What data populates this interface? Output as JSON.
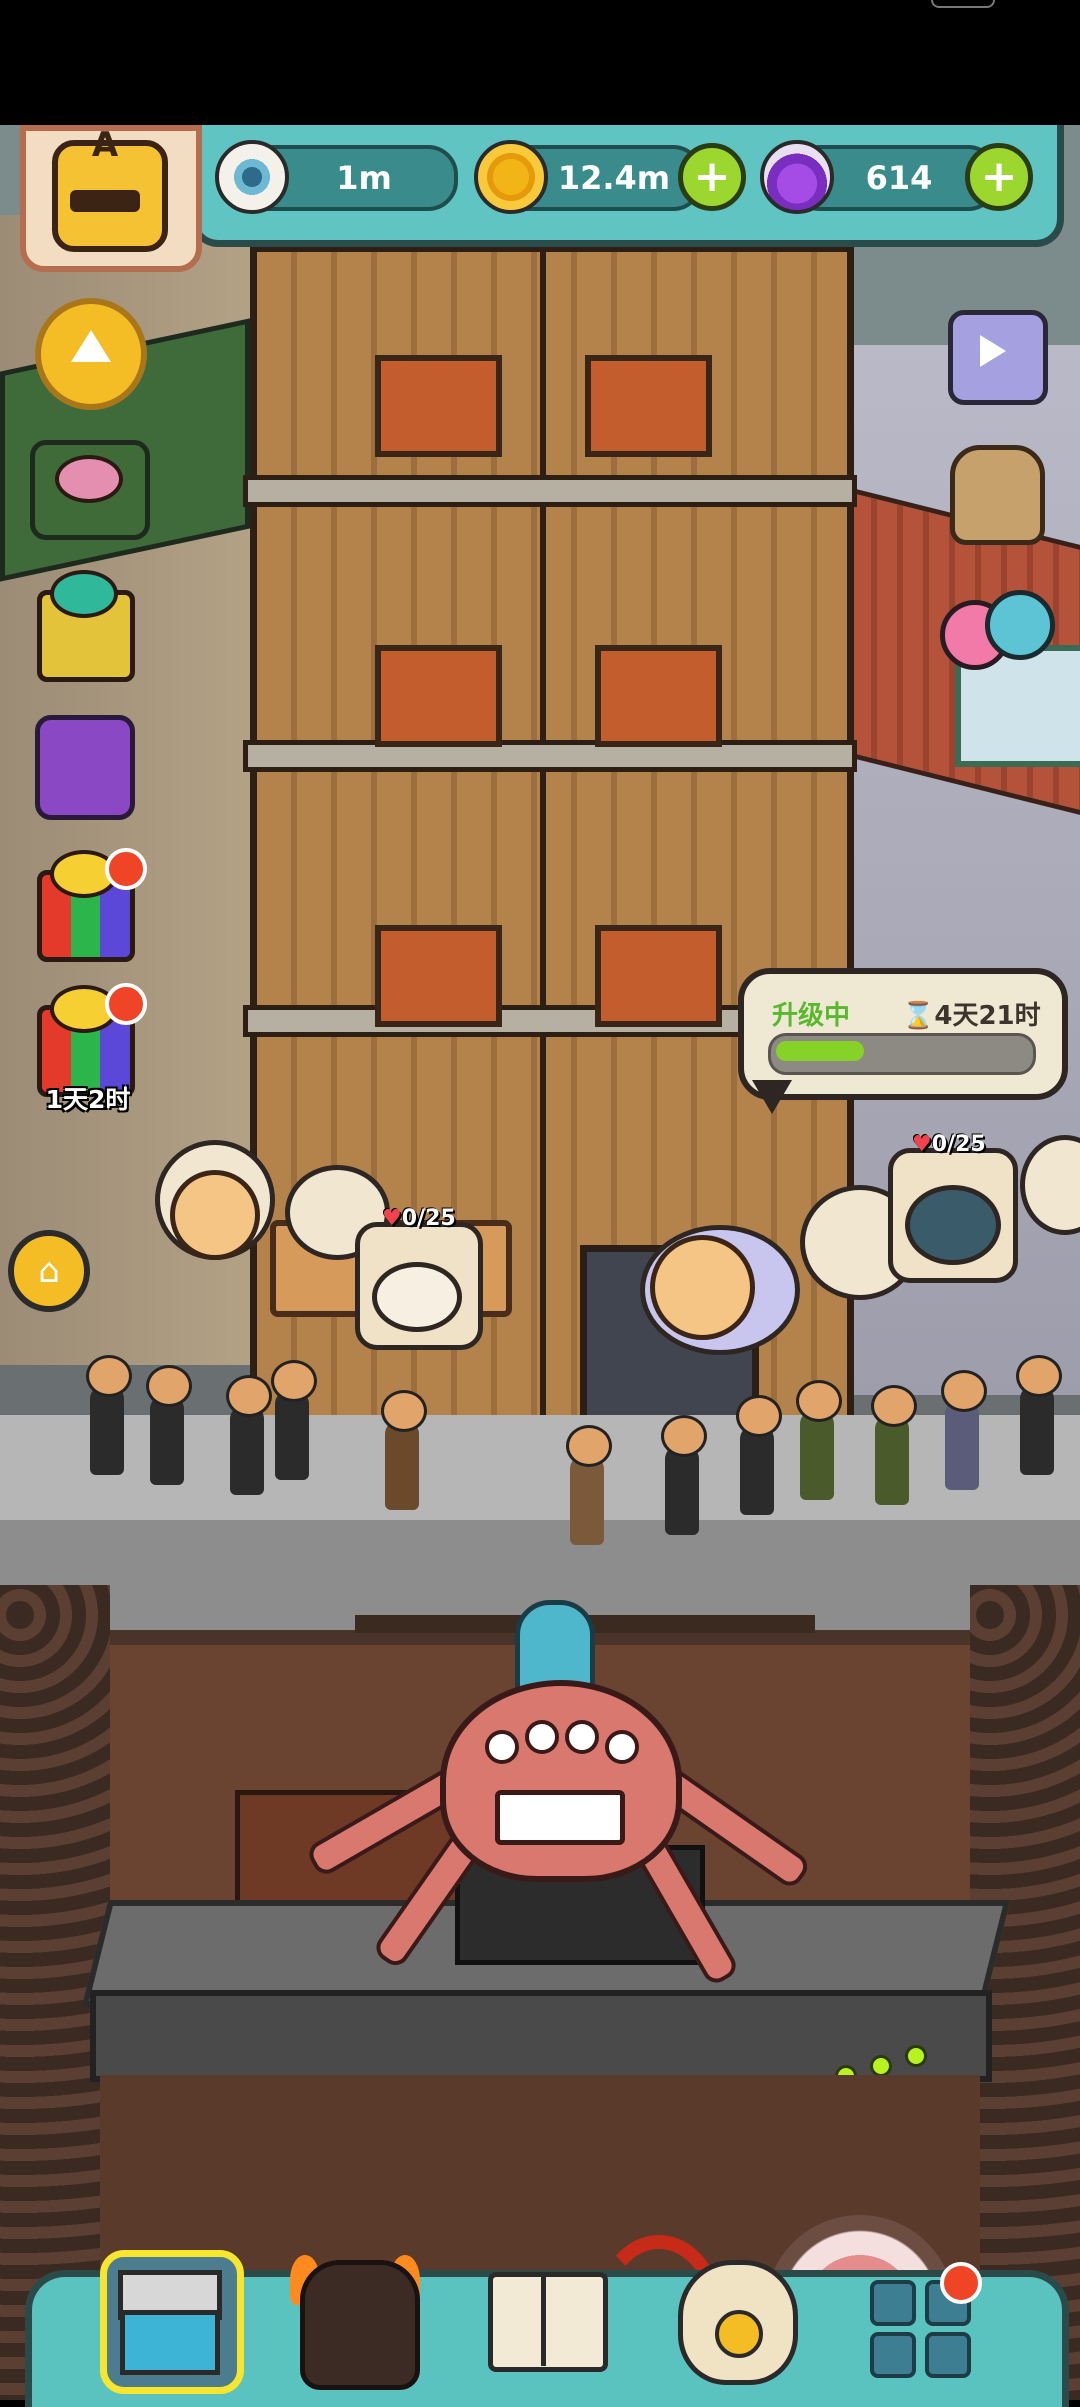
{
  "hud": {
    "badge_letter": "A",
    "eyeball_value": "1m",
    "coin_value": "12.4m",
    "potion_value": "614",
    "plus_label": "+"
  },
  "side": {
    "timer_text": "1天2时"
  },
  "upgrade": {
    "status_label": "升级中",
    "time_left": "⌛4天21时",
    "progress": 0.35
  },
  "orders": {
    "left_count": "0/25",
    "right_count": "0/25"
  },
  "icons": {
    "eyeball": "eyeball-icon",
    "coin": "coin-icon",
    "potion": "potion-icon",
    "home": "home-icon",
    "heart": "heart-icon"
  },
  "colors": {
    "hud_teal": "#5fc4c2",
    "plus_green": "#9bd72f",
    "progress_green": "#86d228",
    "badge_red": "#f04427",
    "active_tab_border": "#f8e52d"
  },
  "bottom_tabs": [
    {
      "name": "shop-tab",
      "active": true
    },
    {
      "name": "monster-tab",
      "active": false
    },
    {
      "name": "book-tab",
      "active": false
    },
    {
      "name": "money-bag-tab",
      "active": false
    },
    {
      "name": "grid-tab",
      "active": false
    }
  ]
}
